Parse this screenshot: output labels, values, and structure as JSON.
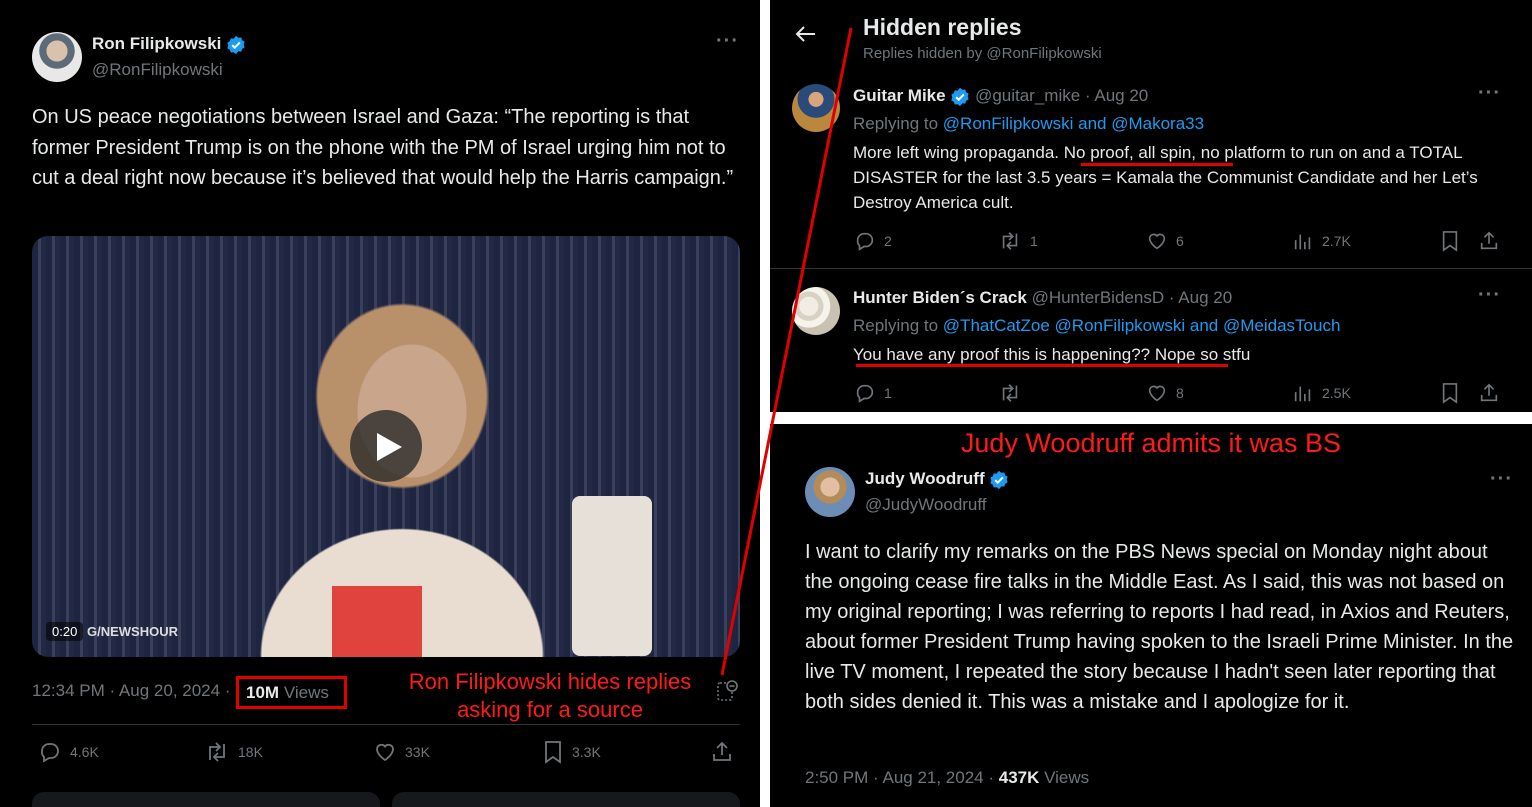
{
  "main_tweet": {
    "author_name": "Ron Filipkowski",
    "handle": "@RonFilipkowski",
    "text": "On US peace negotiations between Israel and Gaza: “The reporting is that former President Trump is on the phone with the PM of Israel urging him not to cut a deal right now because it’s believed that would help the Harris campaign.”",
    "video_time": "0:20",
    "video_watermark": "G/NEWSHOUR",
    "timestamp": "12:34 PM · Aug 20, 2024 ·",
    "views_count": "10M",
    "views_label": "Views",
    "replies": "4.6K",
    "reposts": "18K",
    "likes": "33K",
    "bookmarks": "3.3K"
  },
  "annotations": {
    "left": "Ron Filipkowski hides replies asking for a source",
    "right": "Judy Woodruff admits it was BS",
    "color": "#ff1a1a"
  },
  "hidden_replies": {
    "title": "Hidden replies",
    "subtitle": "Replies hidden by @RonFilipkowski",
    "replies": [
      {
        "name": "Guitar Mike",
        "handle_date": "@guitar_mike · Aug 20",
        "replying_prefix": "Replying to",
        "replying_to": "@RonFilipkowski and @Makora33",
        "text": "More left wing propaganda. No proof, all spin, no platform to run on and a TOTAL DISASTER for the last 3.5 years = Kamala the Communist Candidate and her Let’s Destroy America cult.",
        "replies": "2",
        "reposts": "1",
        "likes": "6",
        "views": "2.7K"
      },
      {
        "name": "Hunter Biden´s Crack",
        "handle_date": "@HunterBidensD · Aug 20",
        "replying_prefix": "Replying to",
        "replying_to": "@ThatCatZoe @RonFilipkowski and @MeidasTouch",
        "text": "You have any proof this is happening?? Nope so stfu",
        "replies": "1",
        "reposts": "",
        "likes": "8",
        "views": "2.5K"
      }
    ]
  },
  "woodruff_tweet": {
    "author_name": "Judy Woodruff",
    "handle": "@JudyWoodruff",
    "text": "I want to clarify my remarks on the PBS News special on Monday night about the ongoing cease fire talks in the Middle East. As I said, this was not based on my original reporting; I was referring to reports I had read, in Axios and Reuters, about former President Trump having spoken to the Israeli Prime Minister. In the live TV moment, I repeated the story because I hadn't seen later reporting that both sides denied it.  This was a mistake and I apologize for it.",
    "timestamp": "2:50 PM · Aug 21, 2024 ·",
    "views_count": "437K",
    "views_label": "Views"
  },
  "colors": {
    "background": "#000000",
    "text": "#e7e9ea",
    "muted": "#71767b",
    "link": "#1d9bf0",
    "verified": "#1d9bf0"
  }
}
